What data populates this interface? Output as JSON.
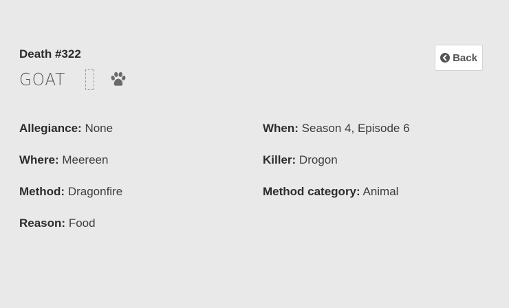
{
  "header": {
    "death_number": "Death #322",
    "victim_name": "GOAT",
    "category_icon": "paw-icon"
  },
  "nav": {
    "back_label": "Back",
    "back_icon": "chevron-circle-left-icon"
  },
  "details": {
    "allegiance": {
      "label": "Allegiance:",
      "value": "None"
    },
    "where": {
      "label": "Where:",
      "value": "Meereen"
    },
    "method": {
      "label": "Method:",
      "value": "Dragonfire"
    },
    "reason": {
      "label": "Reason:",
      "value": "Food"
    },
    "when": {
      "label": "When:",
      "value": "Season 4, Episode 6"
    },
    "killer": {
      "label": "Killer:",
      "value": "Drogon"
    },
    "method_category": {
      "label": "Method category:",
      "value": "Animal"
    }
  },
  "colors": {
    "background": "#e9e9e9",
    "text": "#333333",
    "icon": "#666666"
  }
}
